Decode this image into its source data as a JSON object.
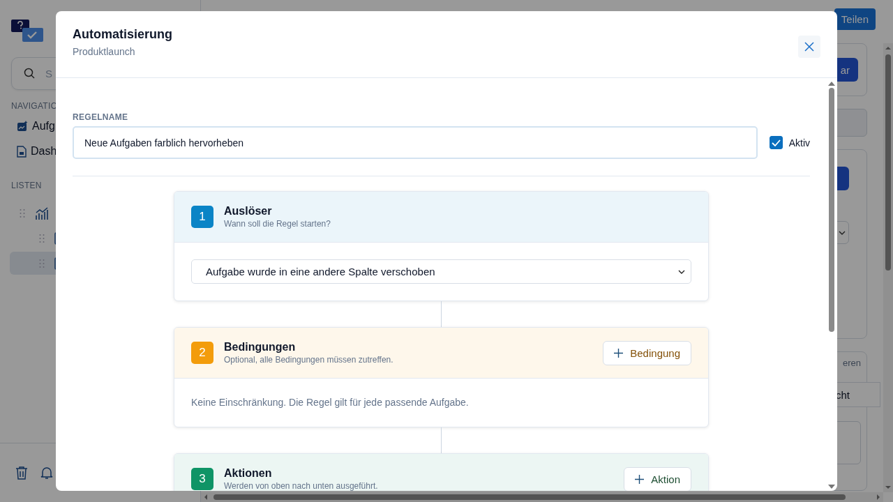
{
  "app": {
    "search": {
      "placeholder": "S"
    },
    "nav_heading": "NAVIGATIO",
    "nav_items": [
      {
        "label": "Aufg",
        "kind": "board"
      },
      {
        "label": "Dash",
        "kind": "doc"
      }
    ],
    "lists_heading": "LISTEN",
    "lists": [
      {
        "selected": false,
        "children": [
          {
            "selected": false
          },
          {
            "selected": true
          }
        ]
      }
    ],
    "share_button": "Teilen",
    "panel": {
      "button": "ar",
      "tab": "eren",
      "row": "cht"
    }
  },
  "dialog": {
    "title": "Automatisierung",
    "subtitle": "Produktlaunch",
    "rule_name": {
      "label": "REGELNAME",
      "value": "Neue Aufgaben farblich hervorheben"
    },
    "active": {
      "label": "Aktiv",
      "checked": true
    },
    "steps": [
      {
        "number": "1",
        "title": "Auslöser",
        "subtitle": "Wann soll die Regel starten?",
        "color": "#0a84c6",
        "kind": "select",
        "value": "Aufgabe wurde in eine andere Spalte verschoben"
      },
      {
        "number": "2",
        "title": "Bedingungen",
        "subtitle": "Optional, alle Bedingungen müssen zutreffen.",
        "color": "#f39c0b",
        "button": "Bedingung",
        "kind": "note",
        "note": "Keine Einschränkung. Die Regel gilt für jede passende Aufgabe."
      },
      {
        "number": "3",
        "title": "Aktionen",
        "subtitle": "Werden von oben nach unten ausgeführt.",
        "color": "#0f9466",
        "button": "Aktion"
      }
    ]
  }
}
